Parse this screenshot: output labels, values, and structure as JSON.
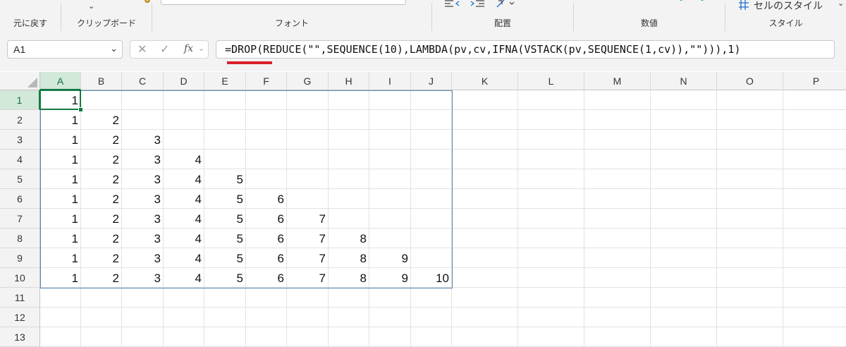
{
  "ribbon": {
    "groups": [
      {
        "label": "元に戻す"
      },
      {
        "label": "クリップボード"
      },
      {
        "label": "フォント"
      },
      {
        "label": "配置"
      },
      {
        "label": "数値"
      },
      {
        "label": "スタイル"
      }
    ],
    "cell_styles_label": "セルのスタイル",
    "icons": [
      "chevron-down-icon",
      "brush-icon",
      "indent-decrease-icon",
      "indent-increase-icon",
      "orientation-icon",
      "cell-styles-icon"
    ]
  },
  "formula_bar": {
    "name_box": "A1",
    "formula": "=DROP(REDUCE(\"\",SEQUENCE(10),LAMBDA(pv,cv,IFNA(VSTACK(pv,SEQUENCE(1,cv)),\"\"))),1)",
    "cancel_glyph": "✕",
    "enter_glyph": "✓",
    "fx_label": "fx",
    "accent_color": "#d9202a"
  },
  "grid": {
    "columns": [
      "A",
      "B",
      "C",
      "D",
      "E",
      "F",
      "G",
      "H",
      "I",
      "J",
      "K",
      "L",
      "M",
      "N",
      "O",
      "P"
    ],
    "rows": [
      "1",
      "2",
      "3",
      "4",
      "5",
      "6",
      "7",
      "8",
      "9",
      "10",
      "11",
      "12",
      "13"
    ],
    "active_cell": "A1",
    "active_color": "#137a43",
    "cells": [
      [
        "1"
      ],
      [
        "1",
        "2"
      ],
      [
        "1",
        "2",
        "3"
      ],
      [
        "1",
        "2",
        "3",
        "4"
      ],
      [
        "1",
        "2",
        "3",
        "4",
        "5"
      ],
      [
        "1",
        "2",
        "3",
        "4",
        "5",
        "6"
      ],
      [
        "1",
        "2",
        "3",
        "4",
        "5",
        "6",
        "7"
      ],
      [
        "1",
        "2",
        "3",
        "4",
        "5",
        "6",
        "7",
        "8"
      ],
      [
        "1",
        "2",
        "3",
        "4",
        "5",
        "6",
        "7",
        "8",
        "9"
      ],
      [
        "1",
        "2",
        "3",
        "4",
        "5",
        "6",
        "7",
        "8",
        "9",
        "10"
      ]
    ]
  }
}
